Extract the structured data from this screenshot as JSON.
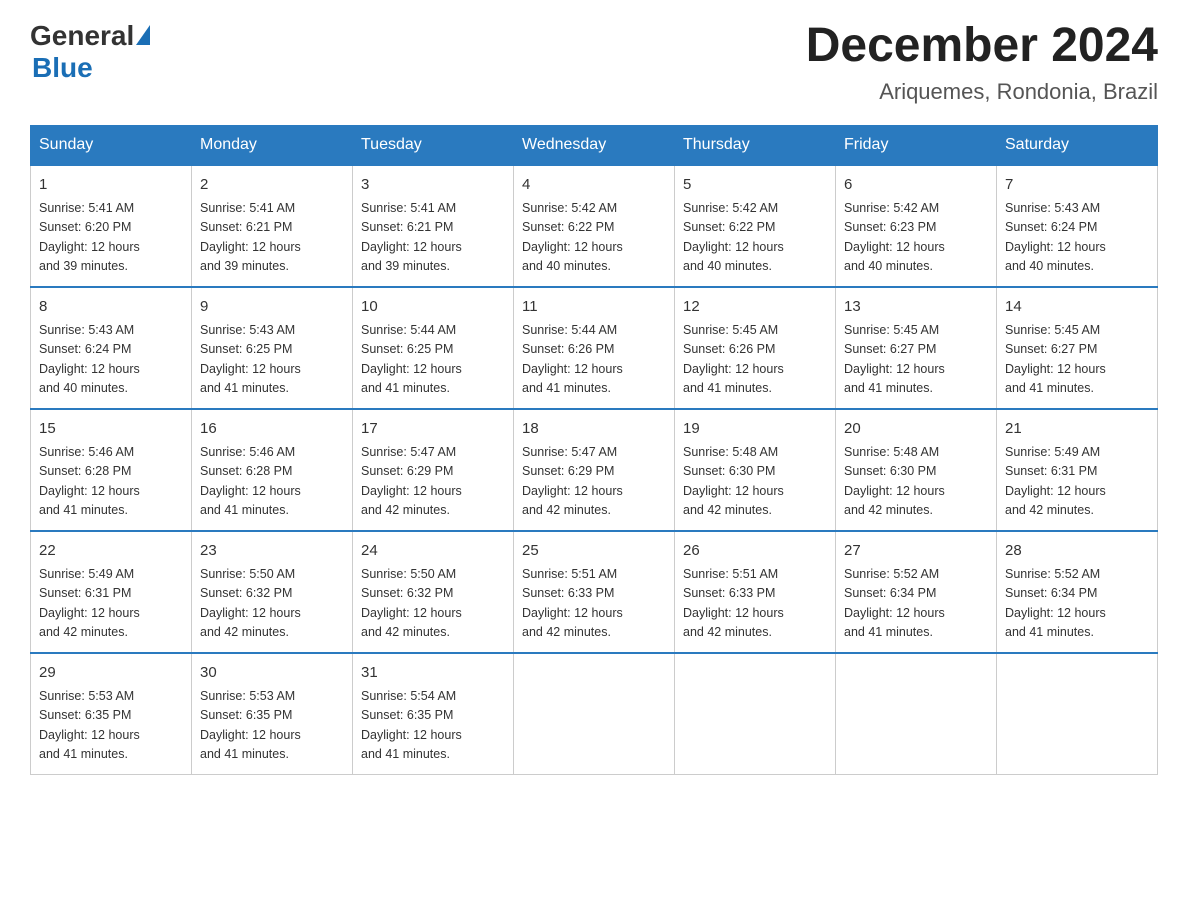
{
  "logo": {
    "general": "General",
    "blue": "Blue"
  },
  "title": "December 2024",
  "subtitle": "Ariquemes, Rondonia, Brazil",
  "days_of_week": [
    "Sunday",
    "Monday",
    "Tuesday",
    "Wednesday",
    "Thursday",
    "Friday",
    "Saturday"
  ],
  "weeks": [
    [
      {
        "day": "1",
        "sunrise": "5:41 AM",
        "sunset": "6:20 PM",
        "daylight": "12 hours and 39 minutes."
      },
      {
        "day": "2",
        "sunrise": "5:41 AM",
        "sunset": "6:21 PM",
        "daylight": "12 hours and 39 minutes."
      },
      {
        "day": "3",
        "sunrise": "5:41 AM",
        "sunset": "6:21 PM",
        "daylight": "12 hours and 39 minutes."
      },
      {
        "day": "4",
        "sunrise": "5:42 AM",
        "sunset": "6:22 PM",
        "daylight": "12 hours and 40 minutes."
      },
      {
        "day": "5",
        "sunrise": "5:42 AM",
        "sunset": "6:22 PM",
        "daylight": "12 hours and 40 minutes."
      },
      {
        "day": "6",
        "sunrise": "5:42 AM",
        "sunset": "6:23 PM",
        "daylight": "12 hours and 40 minutes."
      },
      {
        "day": "7",
        "sunrise": "5:43 AM",
        "sunset": "6:24 PM",
        "daylight": "12 hours and 40 minutes."
      }
    ],
    [
      {
        "day": "8",
        "sunrise": "5:43 AM",
        "sunset": "6:24 PM",
        "daylight": "12 hours and 40 minutes."
      },
      {
        "day": "9",
        "sunrise": "5:43 AM",
        "sunset": "6:25 PM",
        "daylight": "12 hours and 41 minutes."
      },
      {
        "day": "10",
        "sunrise": "5:44 AM",
        "sunset": "6:25 PM",
        "daylight": "12 hours and 41 minutes."
      },
      {
        "day": "11",
        "sunrise": "5:44 AM",
        "sunset": "6:26 PM",
        "daylight": "12 hours and 41 minutes."
      },
      {
        "day": "12",
        "sunrise": "5:45 AM",
        "sunset": "6:26 PM",
        "daylight": "12 hours and 41 minutes."
      },
      {
        "day": "13",
        "sunrise": "5:45 AM",
        "sunset": "6:27 PM",
        "daylight": "12 hours and 41 minutes."
      },
      {
        "day": "14",
        "sunrise": "5:45 AM",
        "sunset": "6:27 PM",
        "daylight": "12 hours and 41 minutes."
      }
    ],
    [
      {
        "day": "15",
        "sunrise": "5:46 AM",
        "sunset": "6:28 PM",
        "daylight": "12 hours and 41 minutes."
      },
      {
        "day": "16",
        "sunrise": "5:46 AM",
        "sunset": "6:28 PM",
        "daylight": "12 hours and 41 minutes."
      },
      {
        "day": "17",
        "sunrise": "5:47 AM",
        "sunset": "6:29 PM",
        "daylight": "12 hours and 42 minutes."
      },
      {
        "day": "18",
        "sunrise": "5:47 AM",
        "sunset": "6:29 PM",
        "daylight": "12 hours and 42 minutes."
      },
      {
        "day": "19",
        "sunrise": "5:48 AM",
        "sunset": "6:30 PM",
        "daylight": "12 hours and 42 minutes."
      },
      {
        "day": "20",
        "sunrise": "5:48 AM",
        "sunset": "6:30 PM",
        "daylight": "12 hours and 42 minutes."
      },
      {
        "day": "21",
        "sunrise": "5:49 AM",
        "sunset": "6:31 PM",
        "daylight": "12 hours and 42 minutes."
      }
    ],
    [
      {
        "day": "22",
        "sunrise": "5:49 AM",
        "sunset": "6:31 PM",
        "daylight": "12 hours and 42 minutes."
      },
      {
        "day": "23",
        "sunrise": "5:50 AM",
        "sunset": "6:32 PM",
        "daylight": "12 hours and 42 minutes."
      },
      {
        "day": "24",
        "sunrise": "5:50 AM",
        "sunset": "6:32 PM",
        "daylight": "12 hours and 42 minutes."
      },
      {
        "day": "25",
        "sunrise": "5:51 AM",
        "sunset": "6:33 PM",
        "daylight": "12 hours and 42 minutes."
      },
      {
        "day": "26",
        "sunrise": "5:51 AM",
        "sunset": "6:33 PM",
        "daylight": "12 hours and 42 minutes."
      },
      {
        "day": "27",
        "sunrise": "5:52 AM",
        "sunset": "6:34 PM",
        "daylight": "12 hours and 41 minutes."
      },
      {
        "day": "28",
        "sunrise": "5:52 AM",
        "sunset": "6:34 PM",
        "daylight": "12 hours and 41 minutes."
      }
    ],
    [
      {
        "day": "29",
        "sunrise": "5:53 AM",
        "sunset": "6:35 PM",
        "daylight": "12 hours and 41 minutes."
      },
      {
        "day": "30",
        "sunrise": "5:53 AM",
        "sunset": "6:35 PM",
        "daylight": "12 hours and 41 minutes."
      },
      {
        "day": "31",
        "sunrise": "5:54 AM",
        "sunset": "6:35 PM",
        "daylight": "12 hours and 41 minutes."
      },
      null,
      null,
      null,
      null
    ]
  ]
}
